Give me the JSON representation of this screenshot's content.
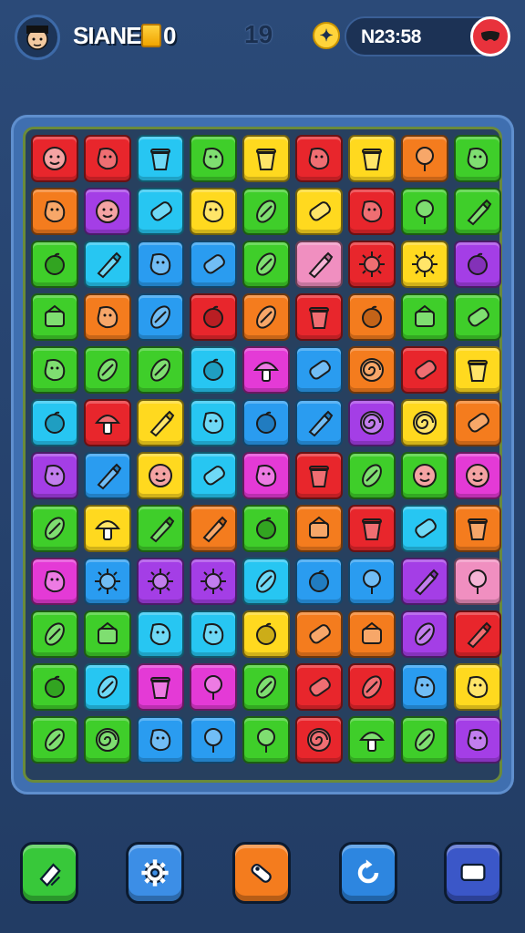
{
  "header": {
    "player_name": "SIANE",
    "gold_value": "0",
    "level": "19",
    "coin_glyph": "✦",
    "score": "N23:58",
    "avatar_icon": "player-face-icon",
    "coin_icon": "coin-icon",
    "score_button_icon": "mask-icon"
  },
  "colors": {
    "red": "#e8262c",
    "orange": "#f47c1e",
    "yellow": "#ffd91f",
    "green": "#3fce2a",
    "blue": "#2a9cf0",
    "cyan": "#27c6f2",
    "purple": "#a43ee6",
    "magenta": "#e43ad6",
    "pink": "#f08fc0"
  },
  "board": {
    "rows": 12,
    "cols": 9,
    "tiles": [
      [
        "red",
        "red",
        "cyan",
        "green",
        "yellow",
        "red",
        "yellow",
        "orange",
        "green"
      ],
      [
        "orange",
        "purple",
        "cyan",
        "yellow",
        "green",
        "yellow",
        "red",
        "green",
        "green"
      ],
      [
        "green",
        "cyan",
        "blue",
        "blue",
        "green",
        "pink",
        "red",
        "yellow",
        "purple"
      ],
      [
        "green",
        "orange",
        "blue",
        "red",
        "orange",
        "red",
        "orange",
        "green",
        "green"
      ],
      [
        "green",
        "green",
        "green",
        "cyan",
        "magenta",
        "blue",
        "orange",
        "red",
        "yellow"
      ],
      [
        "cyan",
        "red",
        "yellow",
        "cyan",
        "blue",
        "blue",
        "purple",
        "yellow",
        "orange"
      ],
      [
        "purple",
        "blue",
        "yellow",
        "cyan",
        "magenta",
        "red",
        "green",
        "green",
        "magenta"
      ],
      [
        "green",
        "yellow",
        "green",
        "orange",
        "green",
        "orange",
        "red",
        "cyan",
        "orange"
      ],
      [
        "magenta",
        "blue",
        "purple",
        "purple",
        "cyan",
        "blue",
        "blue",
        "purple",
        "pink"
      ],
      [
        "green",
        "green",
        "cyan",
        "cyan",
        "yellow",
        "orange",
        "orange",
        "purple",
        "red"
      ],
      [
        "green",
        "cyan",
        "magenta",
        "magenta",
        "green",
        "red",
        "red",
        "blue",
        "yellow"
      ],
      [
        "green",
        "green",
        "blue",
        "blue",
        "green",
        "red",
        "green",
        "green",
        "purple"
      ]
    ],
    "icons": [
      [
        "face-icon",
        "blob-icon",
        "basket-icon",
        "candy-icon",
        "jar-icon",
        "bird-icon",
        "cup-icon",
        "balloon-icon",
        "plant-icon"
      ],
      [
        "magnifier-icon",
        "face-icon",
        "roll-icon",
        "scroll-icon",
        "leaf-icon",
        "bottle-icon",
        "bush-icon",
        "lollipop-icon",
        "brush-icon"
      ],
      [
        "plum-icon",
        "hammer-icon",
        "star-icon",
        "log-icon",
        "leaf-icon",
        "crayon-icon",
        "sun-icon",
        "sun-icon",
        "ball-icon"
      ],
      [
        "box-icon",
        "pumpkin-icon",
        "fish-icon",
        "apple-icon",
        "leaf-icon",
        "pot-icon",
        "plum-icon",
        "house-icon",
        "capsule-icon"
      ],
      [
        "cat-icon",
        "lemon-icon",
        "bean-icon",
        "ball-icon",
        "mushroom-icon",
        "battery-icon",
        "yarn-icon",
        "bottle-icon",
        "bucket-icon"
      ],
      [
        "ball-icon",
        "mushroom-icon",
        "crayon-icon",
        "blob-icon",
        "plum-icon",
        "tube-icon",
        "spiral-icon",
        "spiral-icon",
        "battery-icon"
      ],
      [
        "blob-icon",
        "sword-icon",
        "face-icon",
        "bottle-icon",
        "pear-icon",
        "jar-icon",
        "carrot-icon",
        "face-icon",
        "face-icon"
      ],
      [
        "pickle-icon",
        "mushroom-icon",
        "crayon-icon",
        "hammer-icon",
        "apple-icon",
        "car-icon",
        "pot-icon",
        "bottle-icon",
        "pot-icon"
      ],
      [
        "blob-icon",
        "virus-icon",
        "virus-icon",
        "virus-icon",
        "egg-icon",
        "apple-icon",
        "lollipop-icon",
        "pencil-icon",
        "balloon-icon"
      ],
      [
        "carrot-icon",
        "box-icon",
        "snail-icon",
        "snail-icon",
        "ball-icon",
        "bottle-icon",
        "box-icon",
        "rocket-icon",
        "knife-icon"
      ],
      [
        "plum-icon",
        "bean-icon",
        "vase-icon",
        "lollipop-icon",
        "pickle-icon",
        "bottle-icon",
        "pickle-icon",
        "flower-icon",
        "bird-icon"
      ],
      [
        "fish-icon",
        "spiral-icon",
        "blob-icon",
        "balloon-icon",
        "balloon-icon",
        "shell-icon",
        "broccoli-icon",
        "leaf-icon",
        "brain-icon"
      ]
    ]
  },
  "footer": {
    "buttons": [
      {
        "icon": "flashlight-icon",
        "color": "#38c83a"
      },
      {
        "icon": "gear-icon",
        "color": "#3c8ee6"
      },
      {
        "icon": "tool-icon",
        "color": "#f47c1e"
      },
      {
        "icon": "refresh-icon",
        "color": "#2d86e0"
      },
      {
        "icon": "message-icon",
        "color": "#3b57c8"
      }
    ]
  }
}
